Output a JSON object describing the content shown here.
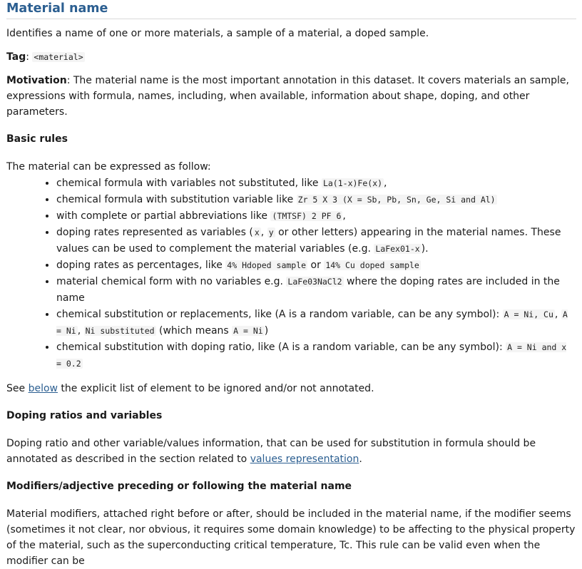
{
  "title": "Material name",
  "description": "Identifies a name of one or more materials, a sample of a material, a doped sample.",
  "tag": {
    "label": "Tag",
    "value": "<material>"
  },
  "motivation": {
    "label": "Motivation",
    "text": ": The material name is the most important annotation in this dataset. It covers materials an sample, expres­sions with formula, names, including, when available, information about shape, doping, and other parameters."
  },
  "basic_rules": {
    "heading": "Basic rules",
    "intro": "The material can be expressed as follow:",
    "items": [
      {
        "t1": "chemical formula with variables not substituted, like ",
        "c1": "La(1-x)Fe(x)",
        "t2": ","
      },
      {
        "t1": "chemical formula with substitution variable like ",
        "c1": "Zr 5 X 3 (X = Sb, Pb, Sn, Ge, Si and Al)"
      },
      {
        "t1": "with complete or partial abbreviations like ",
        "c1": "(TMTSF) 2 PF 6",
        "t2": ","
      },
      {
        "t1": "doping rates represented as variables (",
        "c1": "x",
        "t2": ", ",
        "c2": "y",
        "t3": " or other letters) appearing in the material names. These values can be used to complement the material variables (e.g. ",
        "c3": "LaFex01-x",
        "t4": ")."
      },
      {
        "t1": "doping rates as percentages, like ",
        "c1": "4% Hdoped sample",
        "t2": " or ",
        "c2": "14% Cu doped sample"
      },
      {
        "t1": "material chemical form with no variables e.g. ",
        "c1": "LaFe03NaCl2",
        "t2": " where the doping rates are included in the name"
      },
      {
        "t1": "chemical substitution or replacements, like (A is a random variable, can be any symbol): ",
        "c1": "A = Ni, Cu",
        "t2": ", ",
        "c2": "A = Ni",
        "t3": ", ",
        "c3": "Ni substituted",
        "t4": " (which means ",
        "c4": "A = Ni",
        "t5": ")"
      },
      {
        "t1": "chemical substitution with doping ratio, like (A is a random variable, can be any symbol): ",
        "c1": "A = Ni and x = 0.2"
      }
    ]
  },
  "see_below": {
    "pre": "See ",
    "link": "below",
    "post": " the explicit list of element to be ignored and/or not annotated."
  },
  "doping": {
    "heading": "Doping ratios and variables",
    "text": "Doping ratio and other variable/values information, that can be used for substitution in formula should be annotated as described in the section related to ",
    "link": "values representation",
    "post": "."
  },
  "modifiers": {
    "heading": "Modifiers/adjective preceding or following the material name",
    "text": "Material modifiers, attached right before or after, should be included in the material name, if the modifier seems (sometimes it not clear, nor obvious, it requires some domain knowledge) to be affecting to the physical property of the material, such as the superconducting critical temperature, Tc. This rule can be valid even when the modifier can be"
  }
}
